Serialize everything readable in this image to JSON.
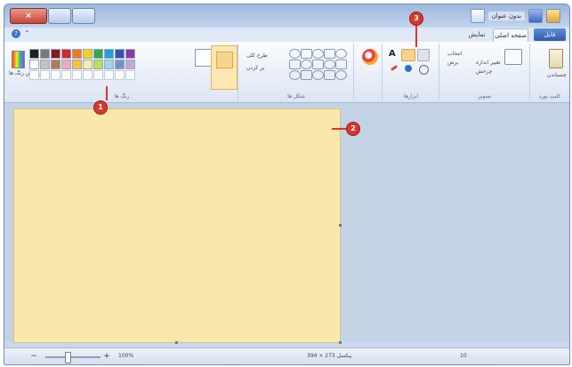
{
  "window": {
    "close_glyph": "×",
    "qat_title": "بدون عنوان"
  },
  "tabs": {
    "file_label": "فایل",
    "home_label": "صفحه اصلی",
    "view_label": "نمایش"
  },
  "ribbon": {
    "groups": {
      "clipboard": "کلیپ بورد",
      "image": "تصویر",
      "tools": "ابزارها",
      "shapes": "شکل ها",
      "colors": "رنگ ها"
    },
    "image_items": [
      "انتخاب",
      "برش",
      "تغییر اندازه",
      "چرخش"
    ],
    "shape_options": [
      "طرح کلی",
      "پر کردن"
    ],
    "edit_colors_label": "ویرایش رنگ ها",
    "paste_label": "چسباندن"
  },
  "palette": {
    "row1": [
      "#1f1f1f",
      "#7a7a7a",
      "#8b1a1a",
      "#d62a2a",
      "#f07a24",
      "#f3d21d",
      "#2fa84d",
      "#20a2d8",
      "#3553b3",
      "#8a3aa6"
    ],
    "row2": [
      "#ffffff",
      "#c3c3c3",
      "#b07a57",
      "#f4a7c2",
      "#f9c23e",
      "#f6eea7",
      "#b8e05a",
      "#9fd6ea",
      "#7690c9",
      "#c7a6d9"
    ],
    "row3_count": 10
  },
  "callouts": {
    "c1": "1",
    "c2": "2",
    "c3": "3"
  },
  "statusbar": {
    "zoom": "100%",
    "dimensions": "394 × 273 پیکسل",
    "page_number": "10",
    "zoom_minus": "−",
    "zoom_plus": "+"
  }
}
